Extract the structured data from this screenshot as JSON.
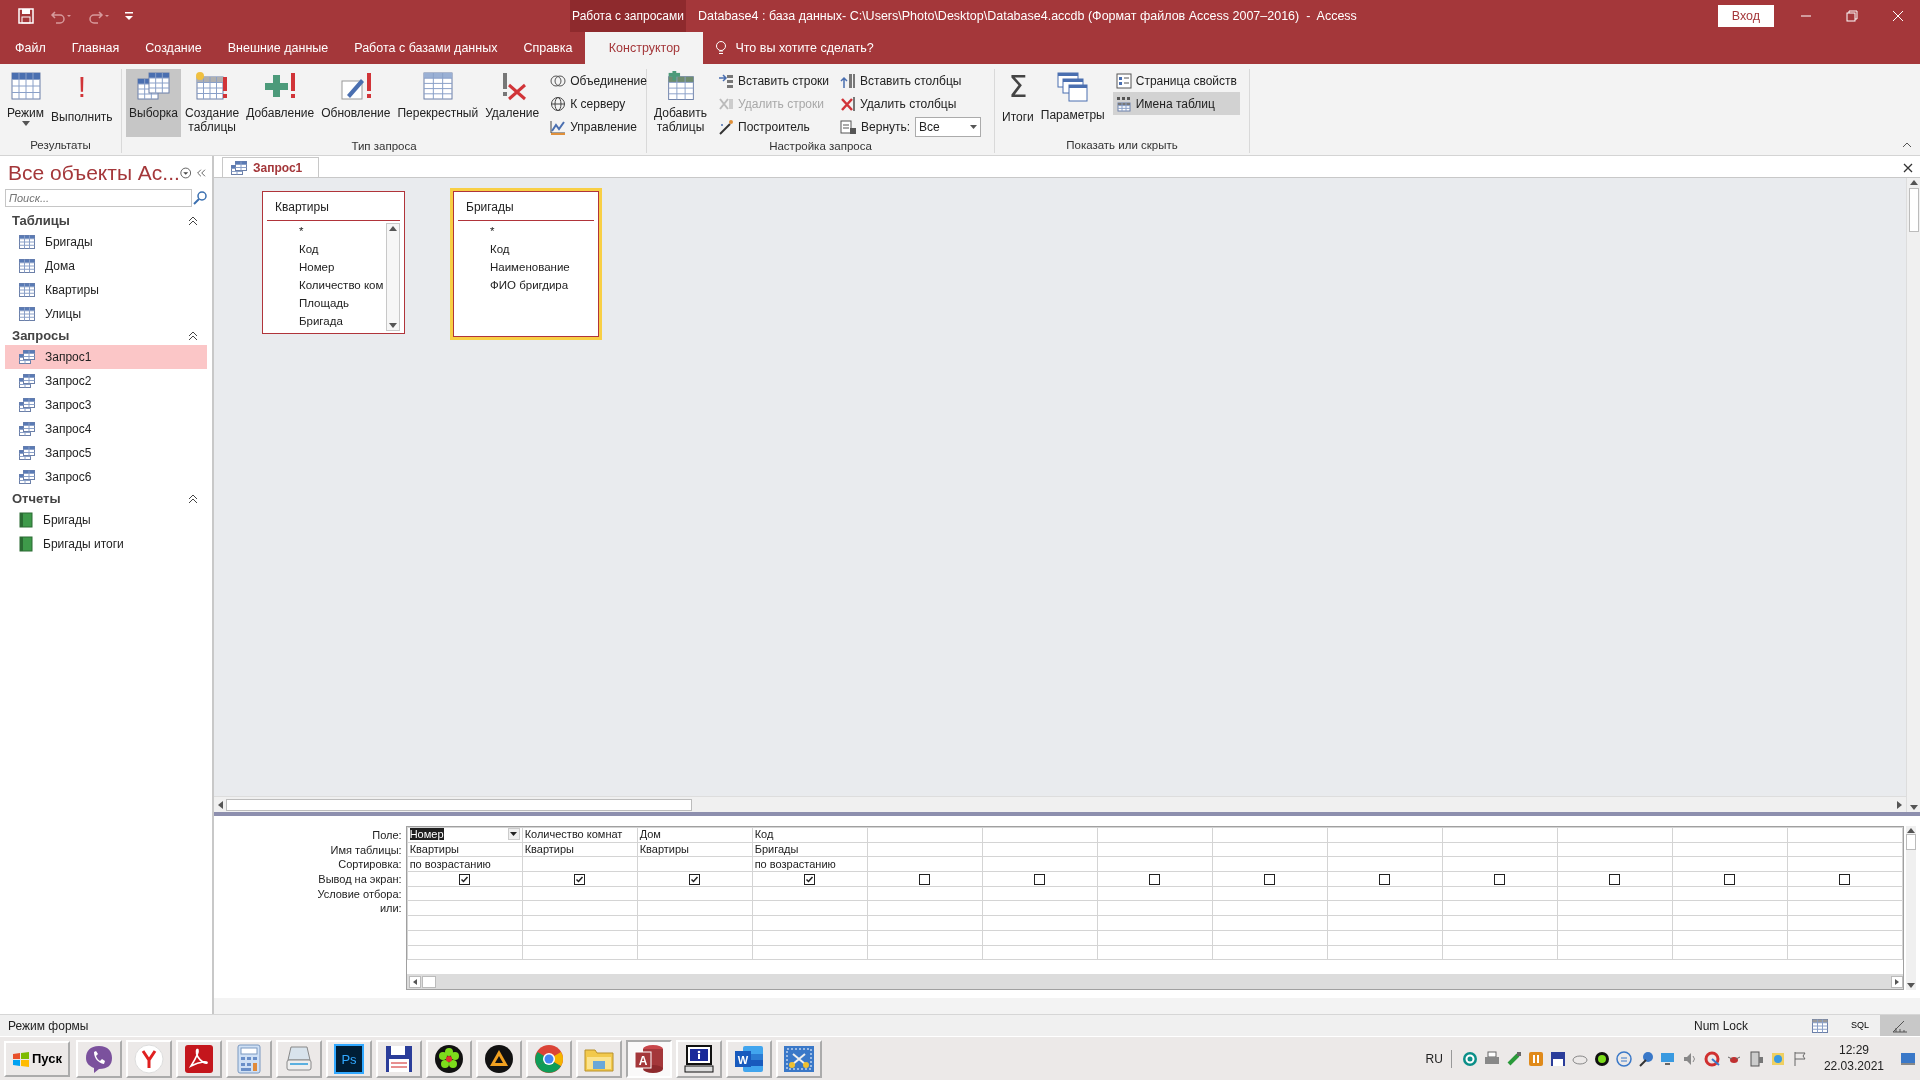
{
  "title_bar": {
    "context_label": "Работа с запросами",
    "title": "Database4 : база данных- C:\\Users\\Photo\\Desktop\\Database4.accdb (Формат файлов Access 2007–2016)  -  Access",
    "sign_in": "Вход"
  },
  "ribbon_tabs": [
    {
      "label": "Файл",
      "selected": false
    },
    {
      "label": "Главная",
      "selected": false
    },
    {
      "label": "Создание",
      "selected": false
    },
    {
      "label": "Внешние данные",
      "selected": false
    },
    {
      "label": "Работа с базами данных",
      "selected": false
    },
    {
      "label": "Справка",
      "selected": false
    },
    {
      "label": "Конструктор",
      "selected": true
    }
  ],
  "tell_me": "Что вы хотите сделать?",
  "ribbon_groups": [
    {
      "label": "Результаты",
      "controls": [
        {
          "kind": "large",
          "label": "Режим",
          "menu": true,
          "selected": false
        },
        {
          "kind": "large",
          "label": "Выполнить",
          "glyph": "!",
          "selected": false
        }
      ]
    },
    {
      "label": "Тип запроса",
      "controls": [
        {
          "kind": "large",
          "label": "Выборка",
          "selected": true
        },
        {
          "kind": "large",
          "label": "Создание\nтаблицы",
          "selected": false
        },
        {
          "kind": "large",
          "label": "Добавление",
          "selected": false
        },
        {
          "kind": "large",
          "label": "Обновление",
          "selected": false
        },
        {
          "kind": "large",
          "label": "Перекрестный",
          "selected": false
        },
        {
          "kind": "large",
          "label": "Удаление",
          "selected": false
        },
        {
          "kind": "stack",
          "items": [
            {
              "kind": "button",
              "label": "Объединение",
              "disabled": false,
              "selected": false
            },
            {
              "kind": "button",
              "label": "К серверу",
              "disabled": false,
              "selected": false
            },
            {
              "kind": "button",
              "label": "Управление",
              "disabled": false,
              "selected": false
            }
          ]
        }
      ]
    },
    {
      "label": "Настройка запроса",
      "controls": [
        {
          "kind": "large",
          "label": "Добавить\nтаблицы",
          "selected": false
        },
        {
          "kind": "stack",
          "items": [
            {
              "kind": "button",
              "label": "Вставить строки",
              "disabled": false,
              "selected": false
            },
            {
              "kind": "button",
              "label": "Удалить строки",
              "disabled": true,
              "selected": false
            },
            {
              "kind": "button",
              "label": "Построитель",
              "disabled": false,
              "selected": false
            }
          ]
        },
        {
          "kind": "stack",
          "items": [
            {
              "kind": "button",
              "label": "Вставить столбцы",
              "disabled": false,
              "selected": false
            },
            {
              "kind": "button",
              "label": "Удалить столбцы",
              "disabled": false,
              "selected": false
            },
            {
              "kind": "combo",
              "label": "Вернуть:",
              "value": "Все"
            }
          ]
        }
      ]
    },
    {
      "label": "Показать или скрыть",
      "controls": [
        {
          "kind": "large",
          "label": "Итоги",
          "glyph": "Σ",
          "selected": false
        },
        {
          "kind": "large",
          "label": "Параметры",
          "selected": false
        },
        {
          "kind": "stack",
          "items": [
            {
              "kind": "button",
              "label": "Страница свойств",
              "disabled": false,
              "selected": false
            },
            {
              "kind": "button",
              "label": "Имена таблиц",
              "disabled": false,
              "selected": true
            }
          ]
        }
      ]
    }
  ],
  "nav": {
    "title": "Все объекты Ac...",
    "search_placeholder": "Поиск...",
    "groups": [
      {
        "label": "Таблицы",
        "kind": "table",
        "expanded": true,
        "items": [
          {
            "label": "Бригады",
            "selected": false
          },
          {
            "label": "Дома",
            "selected": false
          },
          {
            "label": "Квартиры",
            "selected": false
          },
          {
            "label": "Улицы",
            "selected": false
          }
        ]
      },
      {
        "label": "Запросы",
        "kind": "query",
        "expanded": true,
        "items": [
          {
            "label": "Запрос1",
            "selected": true
          },
          {
            "label": "Запрос2",
            "selected": false
          },
          {
            "label": "Запрос3",
            "selected": false
          },
          {
            "label": "Запрос4",
            "selected": false
          },
          {
            "label": "Запрос5",
            "selected": false
          },
          {
            "label": "Запрос6",
            "selected": false
          }
        ]
      },
      {
        "label": "Отчеты",
        "kind": "report",
        "expanded": true,
        "items": [
          {
            "label": "Бригады",
            "selected": false
          },
          {
            "label": "Бригады итоги",
            "selected": false
          }
        ]
      }
    ]
  },
  "document_tabs": [
    {
      "label": "Запрос1",
      "selected": true
    }
  ],
  "tables": [
    {
      "title": "Квартиры",
      "selected": false,
      "scrollbar": true,
      "fields": [
        "*",
        "Код",
        "Номер",
        "Количество ком",
        "Площадь",
        "Бригада"
      ]
    },
    {
      "title": "Бригады",
      "selected": true,
      "scrollbar": false,
      "fields": [
        "*",
        "Код",
        "Наименование",
        "ФИО бригдира"
      ]
    }
  ],
  "grid": {
    "row_labels": [
      "Поле:",
      "Имя таблицы:",
      "Сортировка:",
      "Вывод на экран:",
      "Условие отбора:",
      "или:"
    ],
    "columns": [
      {
        "field": "Номер",
        "table": "Квартиры",
        "sort": "по возрастанию",
        "show": true,
        "selected": true
      },
      {
        "field": "Количество комнат",
        "table": "Квартиры",
        "show": true,
        "selected": false
      },
      {
        "field": "Дом",
        "table": "Квартиры",
        "show": true,
        "selected": false
      },
      {
        "field": "Код",
        "table": "Бригады",
        "sort": "по возрастанию",
        "show": true,
        "selected": false
      },
      {
        "show": false,
        "selected": false
      },
      {
        "show": false,
        "selected": false
      },
      {
        "show": false,
        "selected": false
      },
      {
        "show": false,
        "selected": false
      },
      {
        "show": false,
        "selected": false
      },
      {
        "show": false,
        "selected": false
      },
      {
        "show": false,
        "selected": false
      },
      {
        "show": false,
        "selected": false
      },
      {
        "show": false,
        "selected": false
      }
    ]
  },
  "status_bar": {
    "mode": "Режим формы",
    "num_lock": "Num Lock",
    "views": [
      {
        "kind": "datasheet",
        "selected": false
      },
      {
        "kind": "sql",
        "label": "SQL",
        "selected": false
      },
      {
        "kind": "design",
        "selected": true
      }
    ]
  },
  "taskbar": {
    "start": "Пуск",
    "apps": [
      {
        "kind": "chat",
        "selected": false
      },
      {
        "kind": "letter-y",
        "selected": false
      },
      {
        "kind": "pdf",
        "selected": false
      },
      {
        "kind": "calculator",
        "selected": false
      },
      {
        "kind": "scanner",
        "selected": false
      },
      {
        "kind": "ps",
        "glyph": "Ps",
        "selected": false
      },
      {
        "kind": "floppy",
        "selected": false
      },
      {
        "kind": "flower",
        "selected": false
      },
      {
        "kind": "triangle",
        "selected": false
      },
      {
        "kind": "chrome",
        "selected": false
      },
      {
        "kind": "folder",
        "selected": false
      },
      {
        "kind": "access",
        "glyph": "A",
        "selected": true
      },
      {
        "kind": "info",
        "selected": false
      },
      {
        "kind": "word",
        "glyph": "W",
        "selected": false
      },
      {
        "kind": "scissors",
        "selected": false
      }
    ],
    "language": "RU",
    "time": "12:29",
    "date": "22.03.2021"
  }
}
